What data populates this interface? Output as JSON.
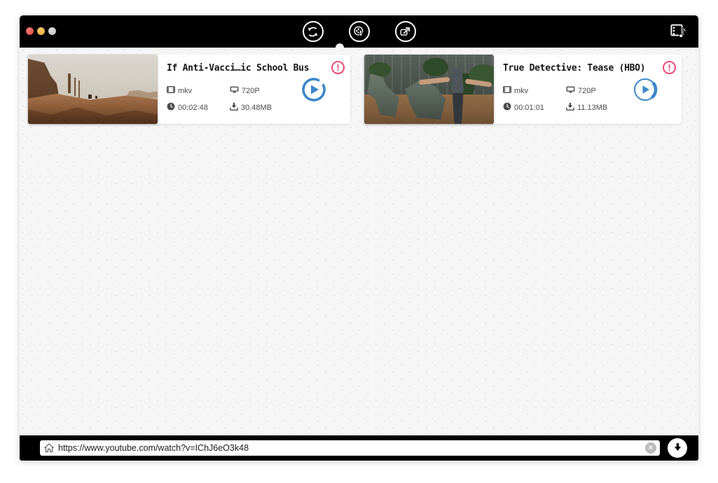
{
  "titlebar": {
    "traffic_lights": [
      {
        "name": "close",
        "color": "#e2463d"
      },
      {
        "name": "minimize",
        "color": "#eda231"
      },
      {
        "name": "zoom-disabled",
        "color": "#b9b9b9"
      }
    ],
    "tools": [
      {
        "id": "refresh",
        "icon": "refresh-icon",
        "active": false
      },
      {
        "id": "downloads",
        "icon": "film-download-icon",
        "active": true
      },
      {
        "id": "share",
        "icon": "share-export-icon",
        "active": false
      }
    ],
    "right_tool": {
      "id": "media-library",
      "icon": "film-music-note-icon"
    }
  },
  "videos": [
    {
      "title": "If Anti-Vacci…ic School Bus",
      "format": "mkv",
      "resolution": "720P",
      "duration": "00:02:48",
      "size": "30.48MB",
      "alert": "!"
    },
    {
      "title": "True Detective: Tease (HBO)",
      "format": "mkv",
      "resolution": "720P",
      "duration": "00:01:01",
      "size": "11.13MB",
      "alert": "!"
    }
  ],
  "bottom_bar": {
    "url": "https://www.youtube.com/watch?v=IChJ6eO3k48",
    "clear_glyph": "×"
  },
  "colors": {
    "accent_blue": "#3d87c9",
    "alert_pink": "#ee4b76",
    "bar_black": "#000000",
    "content_bg": "#f6f6f6",
    "meta_text": "#4a4a4a"
  }
}
